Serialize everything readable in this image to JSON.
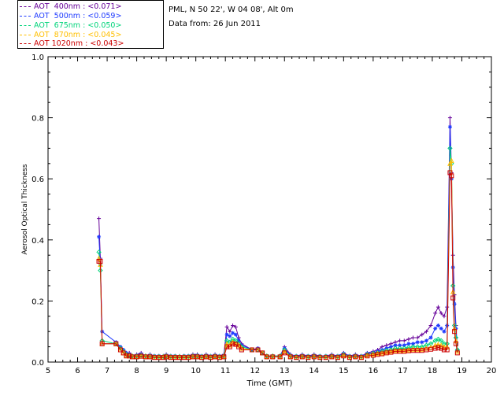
{
  "header": {
    "location": "PML, N 50 22', W 04 08', Alt 0m",
    "date": "Data from: 26 Jun 2011"
  },
  "legend": [
    {
      "label": "AOT  400nm : <0.071>",
      "color": "#660099"
    },
    {
      "label": "AOT  500nm : <0.059>",
      "color": "#1f3bff"
    },
    {
      "label": "AOT  675nm : <0.050>",
      "color": "#00d47a"
    },
    {
      "label": "AOT  870nm : <0.045>",
      "color": "#ffbf00"
    },
    {
      "label": "AOT 1020nm : <0.043>",
      "color": "#cc0000"
    }
  ],
  "chart_data": {
    "type": "line",
    "xlabel": "Time (GMT)",
    "ylabel": "Aerosol Optical Thickness",
    "xlim": [
      5,
      20
    ],
    "ylim": [
      0,
      1.0
    ],
    "xticks": [
      "5",
      "6",
      "7",
      "8",
      "9",
      "10",
      "11",
      "12",
      "13",
      "14",
      "15",
      "16",
      "17",
      "18",
      "19",
      "20"
    ],
    "yticks": [
      "0.0",
      "0.2",
      "0.4",
      "0.6",
      "0.8",
      "1.0"
    ],
    "x": [
      6.72,
      6.77,
      6.83,
      7.3,
      7.45,
      7.55,
      7.65,
      7.75,
      7.85,
      8.0,
      8.15,
      8.3,
      8.45,
      8.6,
      8.75,
      8.9,
      9.0,
      9.15,
      9.3,
      9.45,
      9.6,
      9.75,
      9.9,
      10.05,
      10.2,
      10.35,
      10.5,
      10.65,
      10.8,
      10.95,
      11.05,
      11.15,
      11.25,
      11.35,
      11.45,
      11.55,
      11.9,
      12.1,
      12.25,
      12.4,
      12.6,
      12.85,
      13.0,
      13.2,
      13.4,
      13.6,
      13.8,
      14.0,
      14.2,
      14.4,
      14.6,
      14.8,
      15.0,
      15.2,
      15.4,
      15.6,
      15.8,
      16.0,
      16.15,
      16.3,
      16.45,
      16.6,
      16.75,
      16.9,
      17.05,
      17.2,
      17.35,
      17.5,
      17.65,
      17.8,
      17.95,
      18.1,
      18.2,
      18.3,
      18.4,
      18.5,
      18.6,
      18.65,
      18.7,
      18.75,
      18.8,
      18.85
    ],
    "series": [
      {
        "name": "AOT  400nm",
        "color": "#660099",
        "marker": "plus",
        "values": [
          0.47,
          0.34,
          0.06,
          0.06,
          0.05,
          0.04,
          0.03,
          0.03,
          0.02,
          0.025,
          0.03,
          0.02,
          0.025,
          0.02,
          0.02,
          0.02,
          0.025,
          0.02,
          0.02,
          0.02,
          0.02,
          0.02,
          0.025,
          0.025,
          0.02,
          0.025,
          0.02,
          0.025,
          0.02,
          0.025,
          0.115,
          0.1,
          0.12,
          0.115,
          0.08,
          0.06,
          0.04,
          0.045,
          0.03,
          0.02,
          0.02,
          0.02,
          0.05,
          0.025,
          0.02,
          0.025,
          0.02,
          0.025,
          0.02,
          0.02,
          0.025,
          0.02,
          0.03,
          0.02,
          0.025,
          0.02,
          0.03,
          0.035,
          0.04,
          0.05,
          0.055,
          0.06,
          0.065,
          0.07,
          0.07,
          0.075,
          0.08,
          0.08,
          0.09,
          0.1,
          0.12,
          0.16,
          0.18,
          0.16,
          0.15,
          0.18,
          0.8,
          0.62,
          0.35,
          0.22,
          0.12,
          0.04
        ]
      },
      {
        "name": "AOT  500nm",
        "color": "#1f3bff",
        "marker": "asterisk",
        "values": [
          0.41,
          0.32,
          0.1,
          0.065,
          0.05,
          0.04,
          0.03,
          0.025,
          0.02,
          0.022,
          0.025,
          0.02,
          0.022,
          0.02,
          0.02,
          0.018,
          0.022,
          0.02,
          0.02,
          0.018,
          0.02,
          0.02,
          0.022,
          0.022,
          0.02,
          0.022,
          0.02,
          0.022,
          0.02,
          0.022,
          0.09,
          0.085,
          0.095,
          0.09,
          0.07,
          0.055,
          0.04,
          0.045,
          0.03,
          0.02,
          0.02,
          0.02,
          0.045,
          0.022,
          0.02,
          0.022,
          0.02,
          0.022,
          0.02,
          0.02,
          0.022,
          0.02,
          0.028,
          0.02,
          0.022,
          0.02,
          0.028,
          0.03,
          0.035,
          0.04,
          0.045,
          0.05,
          0.055,
          0.055,
          0.055,
          0.06,
          0.06,
          0.065,
          0.065,
          0.07,
          0.08,
          0.11,
          0.12,
          0.11,
          0.1,
          0.12,
          0.77,
          0.6,
          0.31,
          0.19,
          0.11,
          0.04
        ]
      },
      {
        "name": "AOT  675nm",
        "color": "#00d47a",
        "marker": "diamond",
        "values": [
          0.36,
          0.3,
          0.07,
          0.06,
          0.045,
          0.035,
          0.025,
          0.022,
          0.02,
          0.02,
          0.022,
          0.02,
          0.02,
          0.018,
          0.018,
          0.018,
          0.02,
          0.018,
          0.018,
          0.018,
          0.018,
          0.018,
          0.02,
          0.02,
          0.018,
          0.02,
          0.018,
          0.02,
          0.018,
          0.02,
          0.07,
          0.065,
          0.075,
          0.07,
          0.06,
          0.05,
          0.04,
          0.04,
          0.03,
          0.02,
          0.02,
          0.02,
          0.04,
          0.02,
          0.018,
          0.02,
          0.018,
          0.02,
          0.018,
          0.018,
          0.02,
          0.018,
          0.025,
          0.018,
          0.02,
          0.018,
          0.025,
          0.028,
          0.03,
          0.035,
          0.038,
          0.04,
          0.045,
          0.045,
          0.045,
          0.048,
          0.05,
          0.05,
          0.05,
          0.055,
          0.06,
          0.07,
          0.075,
          0.07,
          0.06,
          0.06,
          0.7,
          0.65,
          0.25,
          0.12,
          0.08,
          0.04
        ]
      },
      {
        "name": "AOT  870nm",
        "color": "#ffbf00",
        "marker": "triangle",
        "values": [
          0.34,
          0.32,
          0.06,
          0.06,
          0.04,
          0.03,
          0.022,
          0.02,
          0.018,
          0.018,
          0.02,
          0.018,
          0.018,
          0.016,
          0.016,
          0.016,
          0.018,
          0.016,
          0.016,
          0.016,
          0.016,
          0.016,
          0.018,
          0.018,
          0.016,
          0.018,
          0.016,
          0.018,
          0.016,
          0.018,
          0.06,
          0.055,
          0.065,
          0.06,
          0.055,
          0.045,
          0.04,
          0.04,
          0.03,
          0.018,
          0.018,
          0.018,
          0.035,
          0.018,
          0.016,
          0.018,
          0.016,
          0.018,
          0.016,
          0.016,
          0.018,
          0.016,
          0.022,
          0.016,
          0.018,
          0.016,
          0.022,
          0.025,
          0.028,
          0.03,
          0.033,
          0.035,
          0.038,
          0.038,
          0.038,
          0.04,
          0.042,
          0.042,
          0.042,
          0.045,
          0.048,
          0.055,
          0.058,
          0.055,
          0.05,
          0.05,
          0.65,
          0.66,
          0.23,
          0.11,
          0.07,
          0.035
        ]
      },
      {
        "name": "AOT 1020nm",
        "color": "#cc0000",
        "marker": "square",
        "values": [
          0.33,
          0.33,
          0.06,
          0.06,
          0.04,
          0.03,
          0.02,
          0.02,
          0.017,
          0.017,
          0.019,
          0.017,
          0.017,
          0.015,
          0.015,
          0.015,
          0.017,
          0.015,
          0.015,
          0.015,
          0.015,
          0.015,
          0.017,
          0.017,
          0.015,
          0.017,
          0.015,
          0.017,
          0.015,
          0.017,
          0.05,
          0.05,
          0.06,
          0.058,
          0.05,
          0.04,
          0.04,
          0.04,
          0.03,
          0.017,
          0.017,
          0.017,
          0.03,
          0.017,
          0.015,
          0.017,
          0.015,
          0.017,
          0.015,
          0.015,
          0.017,
          0.015,
          0.02,
          0.015,
          0.017,
          0.015,
          0.02,
          0.022,
          0.025,
          0.027,
          0.03,
          0.032,
          0.035,
          0.035,
          0.035,
          0.037,
          0.038,
          0.038,
          0.038,
          0.04,
          0.042,
          0.045,
          0.048,
          0.045,
          0.04,
          0.04,
          0.62,
          0.61,
          0.21,
          0.1,
          0.06,
          0.03
        ]
      }
    ]
  }
}
